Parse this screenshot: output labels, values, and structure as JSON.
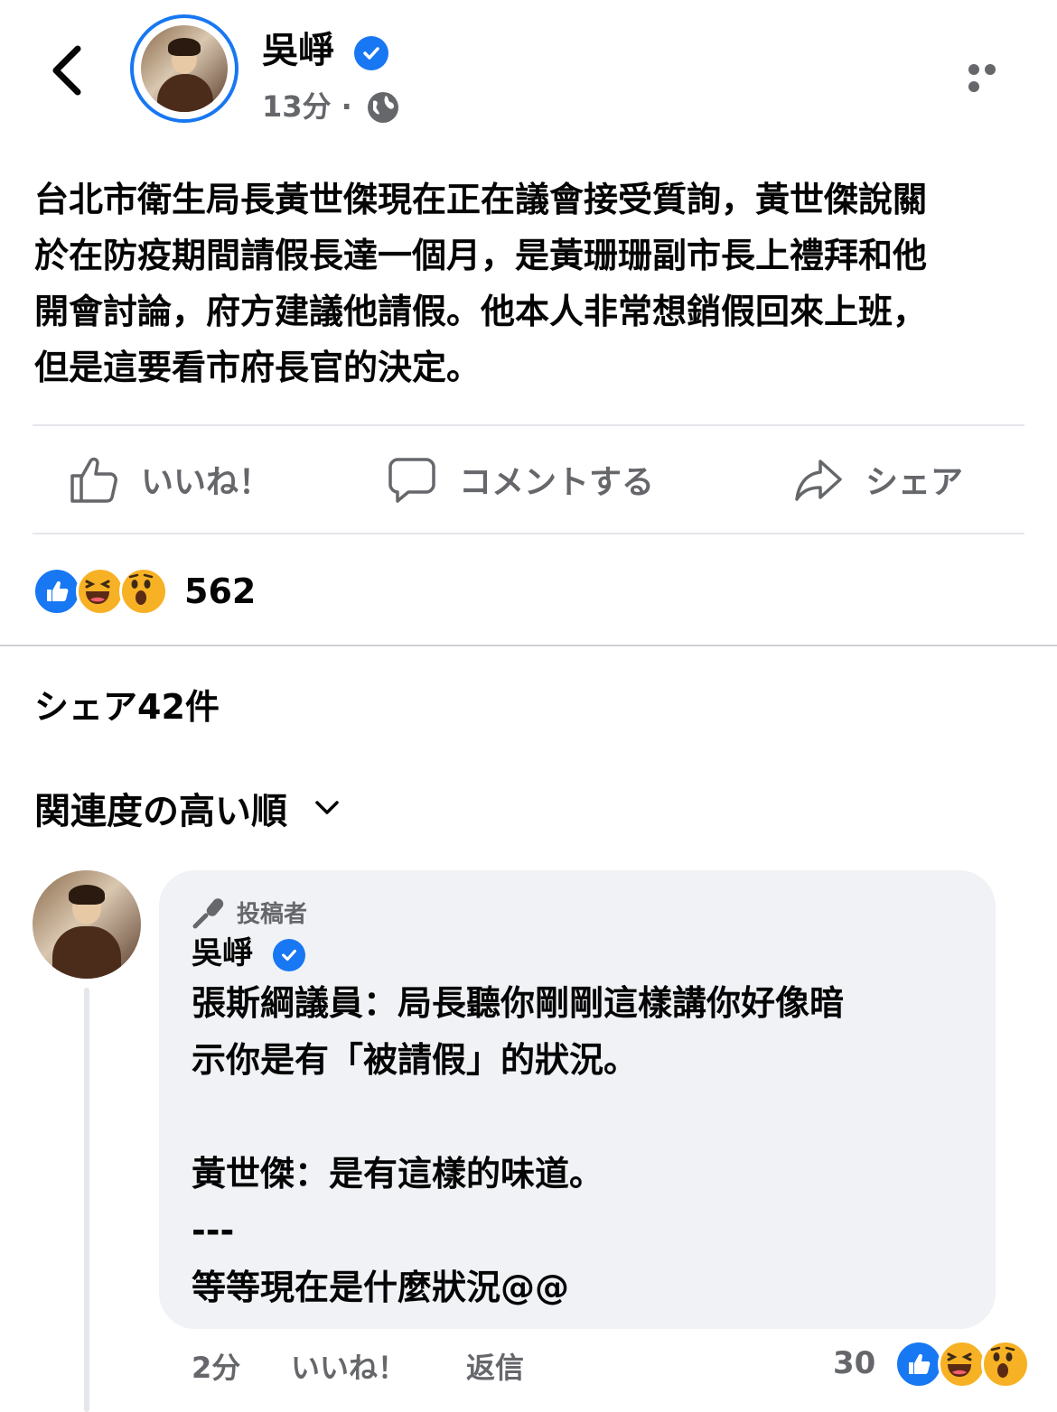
{
  "header": {
    "author_name": "吳崢",
    "post_time": "13分 ·",
    "privacy_icon": "globe-icon"
  },
  "post": {
    "text": "台北市衛生局長黃世傑現在正在議會接受質詢，黃世傑說關\n於在防疫期間請假長達一個月，是黃珊珊副市長上禮拜和他\n開會討論，府方建議他請假。他本人非常想銷假回來上班，\n但是這要看市府長官的決定。"
  },
  "actions": {
    "like_label": "いいね！",
    "comment_label": "コメントする",
    "share_label": "シェア"
  },
  "reactions": {
    "types": [
      "like",
      "haha",
      "wow"
    ],
    "count": "562"
  },
  "shares": {
    "label": "シェア42件"
  },
  "sort": {
    "label": "関連度の高い順"
  },
  "comment": {
    "badge": "投稿者",
    "author_name": "吳崢",
    "text": "張斯綱議員：局長聽你剛剛這樣講你好像暗\n示你是有「被請假」的狀況。\n\n黃世傑：是有這樣的味道。\n---\n等等現在是什麼狀況@@",
    "time": "2分",
    "like_label": "いいね！",
    "reply_label": "返信",
    "reaction_count": "30",
    "reaction_types": [
      "like",
      "haha",
      "wow"
    ]
  },
  "colors": {
    "accent": "#1877f2",
    "secondary_text": "#65676b",
    "bubble_bg": "#f0f2f5",
    "emoji_yellow": "#f7b125"
  }
}
